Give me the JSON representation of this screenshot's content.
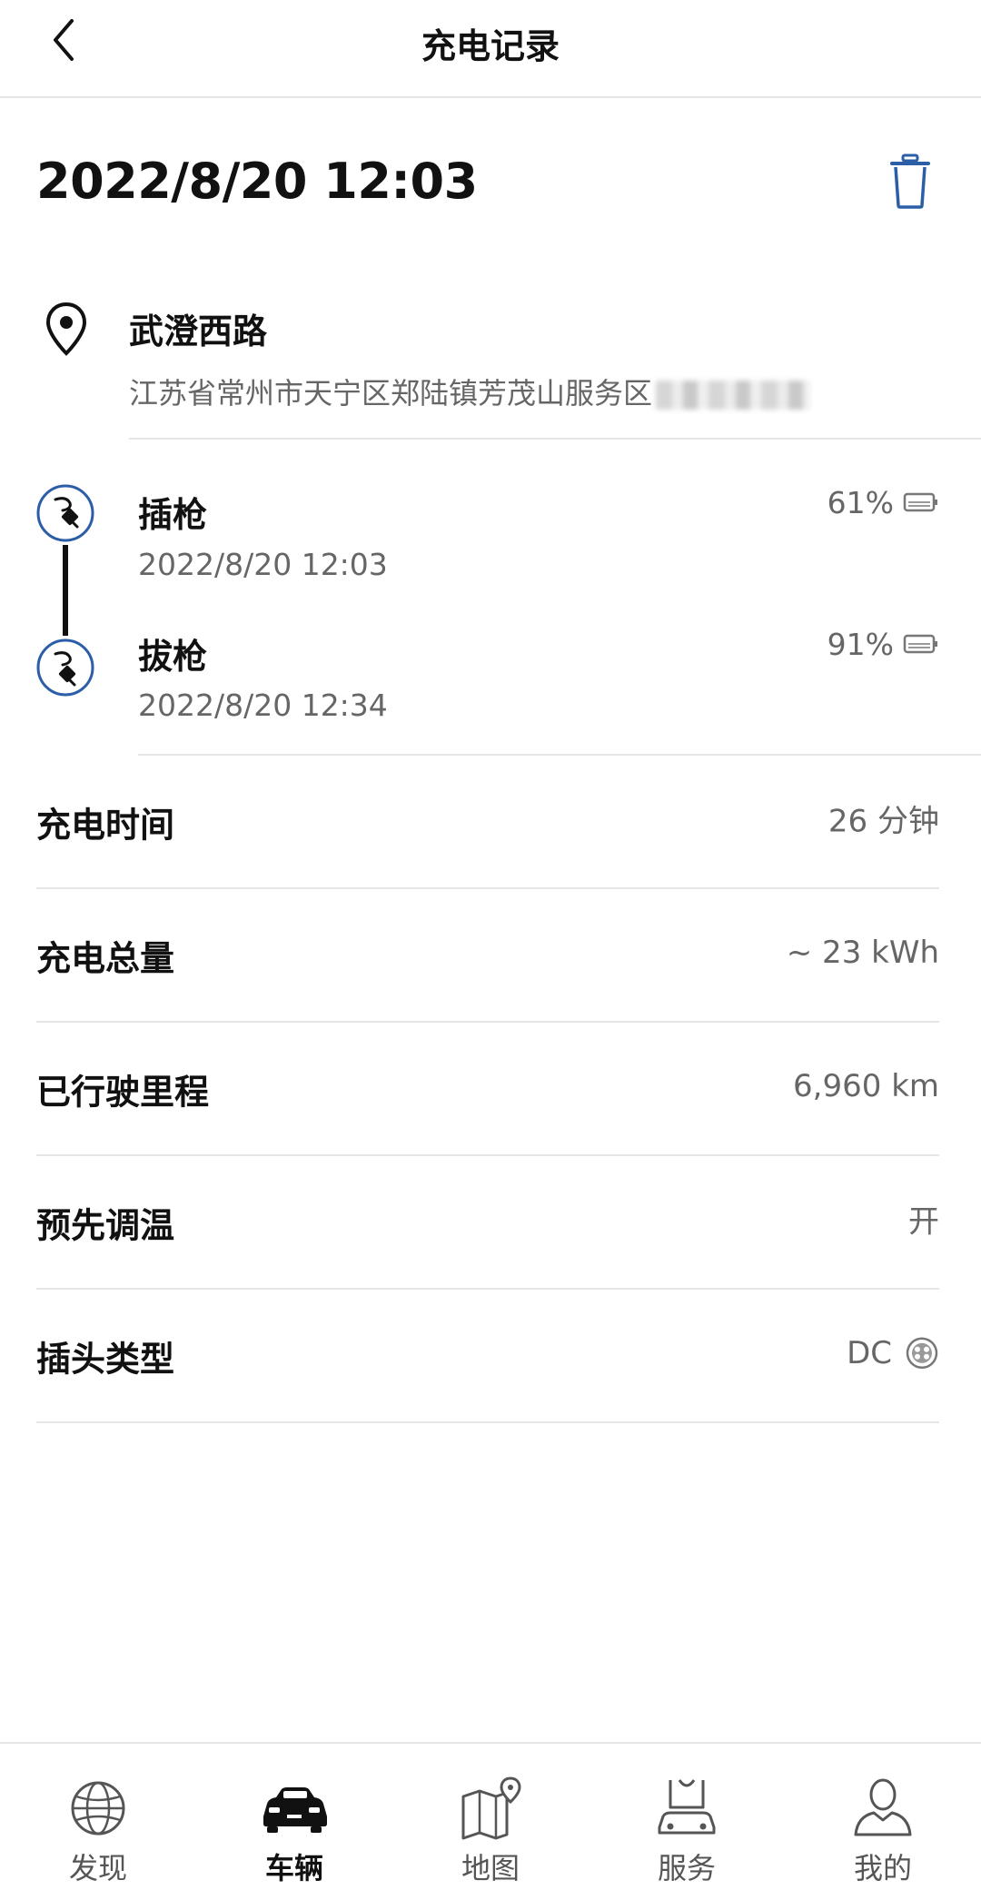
{
  "header": {
    "title": "充电记录"
  },
  "record": {
    "datetime": "2022/8/20 12:03"
  },
  "location": {
    "name": "武澄西路",
    "address": "江苏省常州市天宁区郑陆镇芳茂山服务区"
  },
  "events": [
    {
      "label": "插枪",
      "time": "2022/8/20 12:03",
      "battery_percent": "61%"
    },
    {
      "label": "拔枪",
      "time": "2022/8/20 12:34",
      "battery_percent": "91%"
    }
  ],
  "details": [
    {
      "label": "充电时间",
      "value": "26 分钟"
    },
    {
      "label": "充电总量",
      "value": "~ 23 kWh"
    },
    {
      "label": "已行驶里程",
      "value": "6,960 km"
    },
    {
      "label": "预先调温",
      "value": "开"
    },
    {
      "label": "插头类型",
      "value": "DC"
    }
  ],
  "tabbar": {
    "active_index": 1,
    "items": [
      {
        "label": "发现",
        "icon": "globe-icon"
      },
      {
        "label": "车辆",
        "icon": "car-icon"
      },
      {
        "label": "地图",
        "icon": "map-icon"
      },
      {
        "label": "服务",
        "icon": "service-car-icon"
      },
      {
        "label": "我的",
        "icon": "user-icon"
      }
    ]
  },
  "colors": {
    "accent_blue": "#2b5ea7",
    "text_primary": "#111111",
    "text_secondary": "#666666",
    "divider": "#e6e6e6"
  }
}
